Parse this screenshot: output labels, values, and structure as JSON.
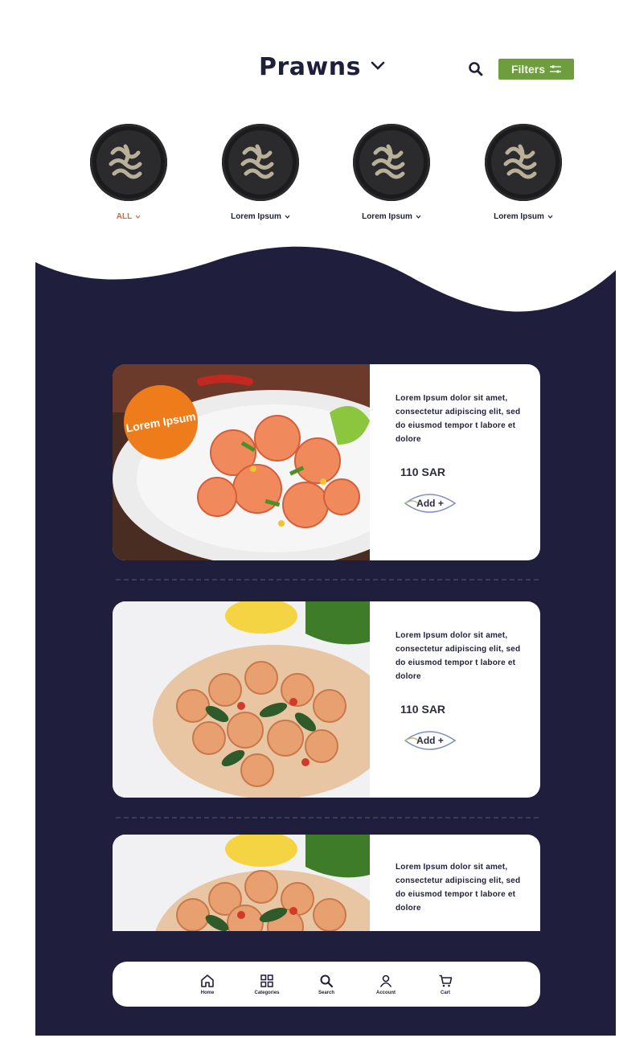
{
  "header": {
    "title": "Prawns",
    "filters_label": "Filters"
  },
  "categories": [
    {
      "label": "ALL",
      "active": true
    },
    {
      "label": "Lorem Ipsum",
      "active": false
    },
    {
      "label": "Lorem Ipsum",
      "active": false
    },
    {
      "label": "Lorem Ipsum",
      "active": false
    }
  ],
  "products": [
    {
      "badge": "Lorem Ipsum",
      "description": "Lorem Ipsum dolor sit amet, consectetur adipiscing elit, sed do eiusmod tempor t labore et dolore",
      "price": "110 SAR",
      "add_label": "Add +"
    },
    {
      "description": "Lorem Ipsum dolor sit amet, consectetur adipiscing elit, sed do eiusmod tempor t labore et dolore",
      "price": "110 SAR",
      "add_label": "Add +"
    },
    {
      "description": "Lorem Ipsum dolor sit amet, consectetur adipiscing elit, sed do eiusmod tempor t labore et dolore"
    }
  ],
  "bottom_nav": [
    {
      "label": "Home",
      "icon": "home-icon"
    },
    {
      "label": "Categories",
      "icon": "categories-icon"
    },
    {
      "label": "Search",
      "icon": "search-icon"
    },
    {
      "label": "Account",
      "icon": "account-icon"
    },
    {
      "label": "Cart",
      "icon": "cart-icon"
    }
  ],
  "colors": {
    "navy": "#1f1f3d",
    "accent_orange": "#ef7c1a",
    "filters_green": "#6e9d3f"
  }
}
